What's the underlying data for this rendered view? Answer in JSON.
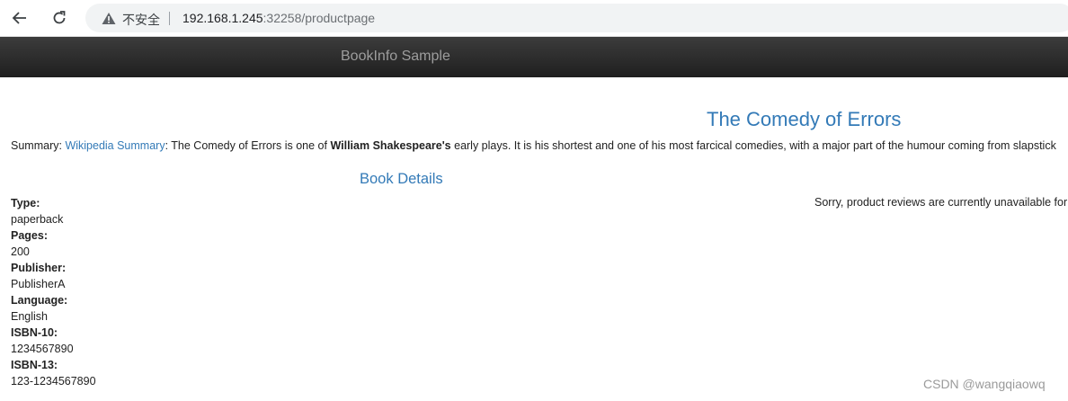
{
  "browser": {
    "insecure_label": "不安全",
    "url_host": "192.168.1.245",
    "url_rest": ":32258/productpage"
  },
  "navbar": {
    "brand": "BookInfo Sample"
  },
  "product": {
    "title": "The Comedy of Errors",
    "summary_prefix": "Summary: ",
    "summary_link": "Wikipedia Summary",
    "summary_text_1": ": The Comedy of Errors is one of ",
    "summary_bold": "William Shakespeare's",
    "summary_text_2": " early plays. It is his shortest and one of his most farcical comedies, with a major part of the humour coming from slapstick"
  },
  "details": {
    "heading": "Book Details",
    "items": [
      {
        "label": "Type:",
        "value": "paperback"
      },
      {
        "label": "Pages:",
        "value": "200"
      },
      {
        "label": "Publisher:",
        "value": "PublisherA"
      },
      {
        "label": "Language:",
        "value": "English"
      },
      {
        "label": "ISBN-10:",
        "value": "1234567890"
      },
      {
        "label": "ISBN-13:",
        "value": "123-1234567890"
      }
    ]
  },
  "reviews": {
    "message": "Sorry, product reviews are currently unavailable for"
  },
  "watermark": "CSDN @wangqiaowq"
}
